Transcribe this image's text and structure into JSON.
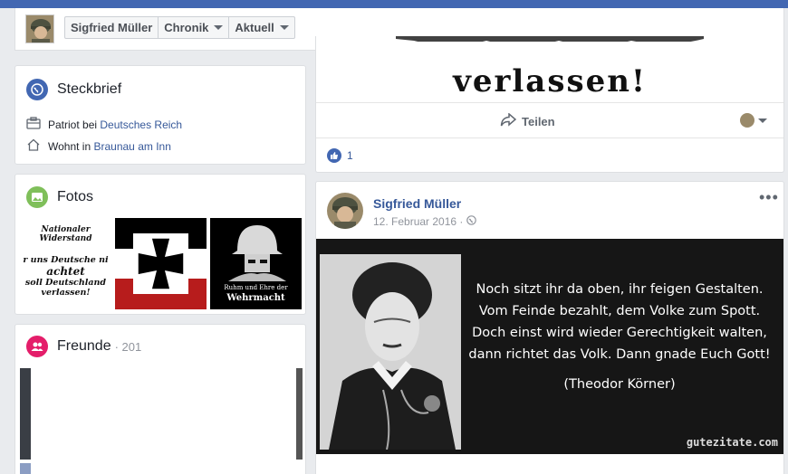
{
  "header": {
    "name": "Sigfried Müller",
    "nav": [
      {
        "label": "Sigfried Müller"
      },
      {
        "label": "Chronik"
      },
      {
        "label": "Aktuell"
      }
    ]
  },
  "steckbrief": {
    "title": "Steckbrief",
    "work_prefix": "Patriot bei ",
    "work_link": "Deutsches Reich",
    "home_prefix": "Wohnt in ",
    "home_link": "Braunau am Inn"
  },
  "fotos": {
    "title": "Fotos",
    "photo1_lines": [
      "Nationaler Widerstand",
      "r uns Deutsche ni",
      "achtet",
      "soll Deutschland",
      "verlassen!"
    ],
    "photo3_lines": [
      "Ruhm und Ehre der",
      "Wehrmacht"
    ]
  },
  "freunde": {
    "title": "Freunde",
    "count": "· 201"
  },
  "prev_post": {
    "image_text": "verlassen!",
    "share_label": "Teilen",
    "like_count": "1"
  },
  "post": {
    "author": "Sigfried Müller",
    "date": "12. Februar 2016 ·",
    "quote": [
      "Noch sitzt ihr da oben, ihr feigen Gestalten.",
      "Vom Feinde bezahlt, dem Volke zum Spott.",
      "Doch einst wird wieder Gerechtigkeit walten,",
      "dann richtet das Volk. Dann gnade Euch Gott!"
    ],
    "quote_author": "(Theodor Körner)",
    "watermark": "gutezitate.com"
  },
  "colors": {
    "brand": "#4267b2",
    "link": "#365899"
  }
}
